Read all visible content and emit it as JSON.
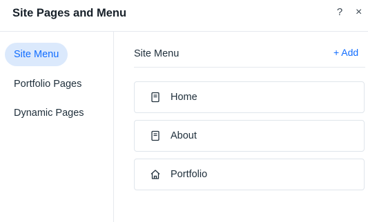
{
  "header": {
    "title": "Site Pages and Menu",
    "help_label": "?",
    "close_label": "×"
  },
  "sidebar": {
    "items": [
      {
        "label": "Site Menu",
        "active": true
      },
      {
        "label": "Portfolio Pages",
        "active": false
      },
      {
        "label": "Dynamic Pages",
        "active": false
      }
    ]
  },
  "main": {
    "section_title": "Site Menu",
    "add_label": "+ Add",
    "pages": [
      {
        "label": "Home",
        "icon": "page-icon"
      },
      {
        "label": "About",
        "icon": "page-icon"
      },
      {
        "label": "Portfolio",
        "icon": "home-icon"
      }
    ]
  },
  "colors": {
    "accent": "#116dff",
    "active_bg": "#dbe9fc",
    "text": "#20303c",
    "border": "#dfe5eb"
  }
}
